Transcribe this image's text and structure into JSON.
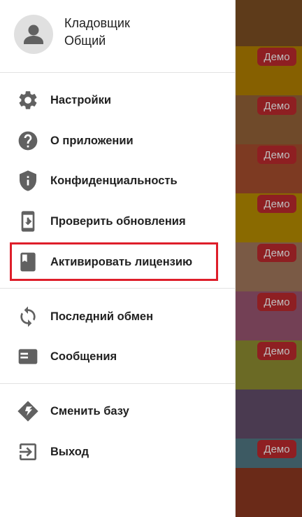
{
  "user": {
    "name": "Кладовщик",
    "role": "Общий"
  },
  "menu": {
    "section1": [
      {
        "label": "Настройки",
        "icon": "gear-icon"
      },
      {
        "label": "О приложении",
        "icon": "help-circle-icon"
      },
      {
        "label": "Конфиденциальность",
        "icon": "shield-info-icon"
      },
      {
        "label": "Проверить обновления",
        "icon": "phone-download-icon"
      },
      {
        "label": "Активировать лицензию",
        "icon": "book-icon"
      }
    ],
    "section2": [
      {
        "label": "Последний обмен",
        "icon": "sync-icon"
      },
      {
        "label": "Сообщения",
        "icon": "message-card-icon"
      }
    ],
    "section3": [
      {
        "label": "Сменить базу",
        "icon": "switch-base-icon"
      },
      {
        "label": "Выход",
        "icon": "exit-icon"
      }
    ]
  },
  "background": {
    "badge_label": "Демо",
    "rows": [
      {
        "color": "#5e3b1a",
        "badge": false
      },
      {
        "color": "#866000",
        "badge": true
      },
      {
        "color": "#6f4a2a",
        "badge": true
      },
      {
        "color": "#7d3a22",
        "badge": true
      },
      {
        "color": "#8a6a00",
        "badge": true
      },
      {
        "color": "#7a5a45",
        "badge": true
      },
      {
        "color": "#734055",
        "badge": true
      },
      {
        "color": "#6b6a25",
        "badge": true
      },
      {
        "color": "#4a3a50",
        "badge": false
      },
      {
        "color": "#3d5a63",
        "badge": true
      },
      {
        "color": "#6a2a18",
        "badge": false
      }
    ]
  },
  "colors": {
    "icon": "#616161",
    "highlight": "#de1e2a",
    "badge_bg": "#8e1f22"
  }
}
